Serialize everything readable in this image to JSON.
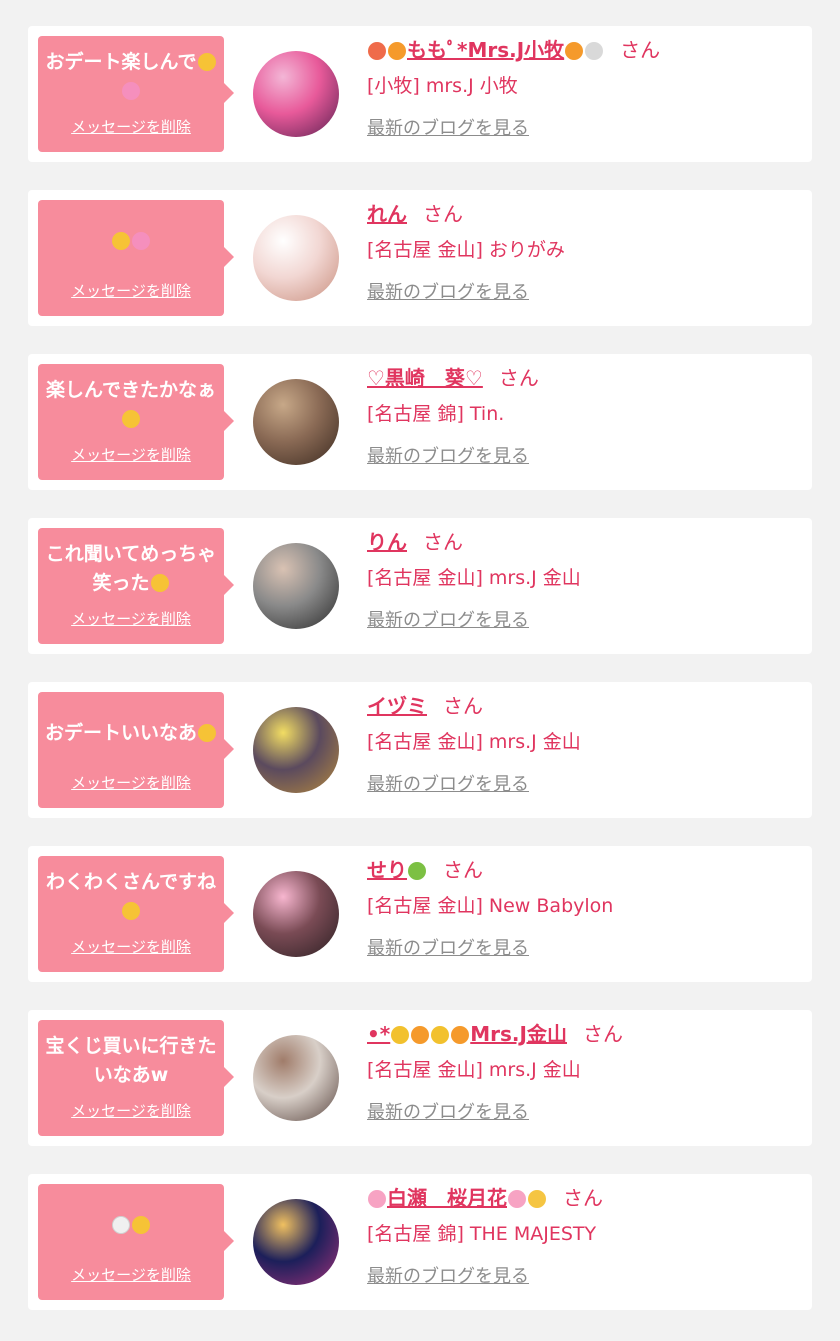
{
  "delete_label": "メッセージを削除",
  "san_label": "さん",
  "blog_label": "最新のブログを見る",
  "colors": {
    "background": "#f2f2f2",
    "card": "#ffffff",
    "bubble": "#f78c9c",
    "name": "#e0355f",
    "link_gray": "#8c8c8c"
  },
  "items": [
    {
      "message": "おデート楽しんで",
      "message_icons": [
        "pleading-face-emoji",
        "pink-heart-emoji"
      ],
      "name": "ももﾟ*Mrs.J小牧",
      "name_icons_before": [
        "peach-emoji",
        "orange-heart-emoji"
      ],
      "name_icons_after": [
        "orange-heart-emoji",
        "rabbit-emoji"
      ],
      "shop": "[小牧] mrs.J 小牧",
      "avatar_colors": [
        "#e85a9a",
        "#5a2050",
        "#f3b6d6"
      ]
    },
    {
      "message": "",
      "message_icons": [
        "hand-over-mouth-emoji",
        "sparkling-heart-emoji"
      ],
      "name": "れん",
      "name_icons_before": [],
      "name_icons_after": [],
      "shop": "[名古屋 金山] おりがみ",
      "avatar_colors": [
        "#f2d7d3",
        "#c98f7e",
        "#ffffff"
      ]
    },
    {
      "message": "楽しんできたかなぁ",
      "message_icons": [
        "smiling-face-with-hearts-emoji"
      ],
      "name": "♡黒崎　葵♡",
      "name_icons_before": [],
      "name_icons_after": [],
      "shop": "[名古屋 錦] Tin.",
      "avatar_colors": [
        "#8a6a55",
        "#3b2a20",
        "#c7a888"
      ]
    },
    {
      "message": "これ聞いてめっちゃ笑った",
      "message_icons": [
        "rolling-on-floor-laughing-emoji"
      ],
      "name": "りん",
      "name_icons_before": [],
      "name_icons_after": [],
      "shop": "[名古屋 金山] mrs.J 金山",
      "avatar_colors": [
        "#8a8a8a",
        "#2a2a2a",
        "#d9c2b3"
      ]
    },
    {
      "message": "おデートいいなあ",
      "message_icons": [
        "pleading-face-emoji"
      ],
      "name": "イヅミ",
      "name_icons_before": [],
      "name_icons_after": [],
      "shop": "[名古屋 金山] mrs.J 金山",
      "avatar_colors": [
        "#5b4a5e",
        "#b5893e",
        "#f2dd63"
      ]
    },
    {
      "message": "わくわくさんですね",
      "message_icons": [
        "partying-face-emoji"
      ],
      "name": "せり",
      "name_icons_before": [],
      "name_icons_after": [
        "pineapple-emoji"
      ],
      "shop": "[名古屋 金山] New Babylon",
      "avatar_colors": [
        "#7a4b55",
        "#2b1f22",
        "#f7b6cf"
      ]
    },
    {
      "message": "宝くじ買いに行きたいなあw",
      "message_icons": [],
      "name": "Mrs.J金山",
      "name_prefix": "•*",
      "name_icons_before": [
        "bee-emoji",
        "orange-heart-emoji",
        "bee-emoji",
        "orange-heart-emoji"
      ],
      "name_icons_after": [],
      "shop": "[名古屋 金山] mrs.J 金山",
      "avatar_colors": [
        "#d8cfc8",
        "#5a4640",
        "#a07c6a"
      ]
    },
    {
      "message": "",
      "message_icons": [
        "white-heart-emoji",
        "thumbs-up-emoji"
      ],
      "name": "白瀬　桜月花",
      "name_icons_before": [
        "cherry-blossom-emoji"
      ],
      "name_icons_after": [
        "cherry-blossom-emoji",
        "crescent-moon-emoji"
      ],
      "shop": "[名古屋 錦] THE MAJESTY",
      "avatar_colors": [
        "#1c1f5a",
        "#a0327a",
        "#f0c060"
      ]
    }
  ]
}
